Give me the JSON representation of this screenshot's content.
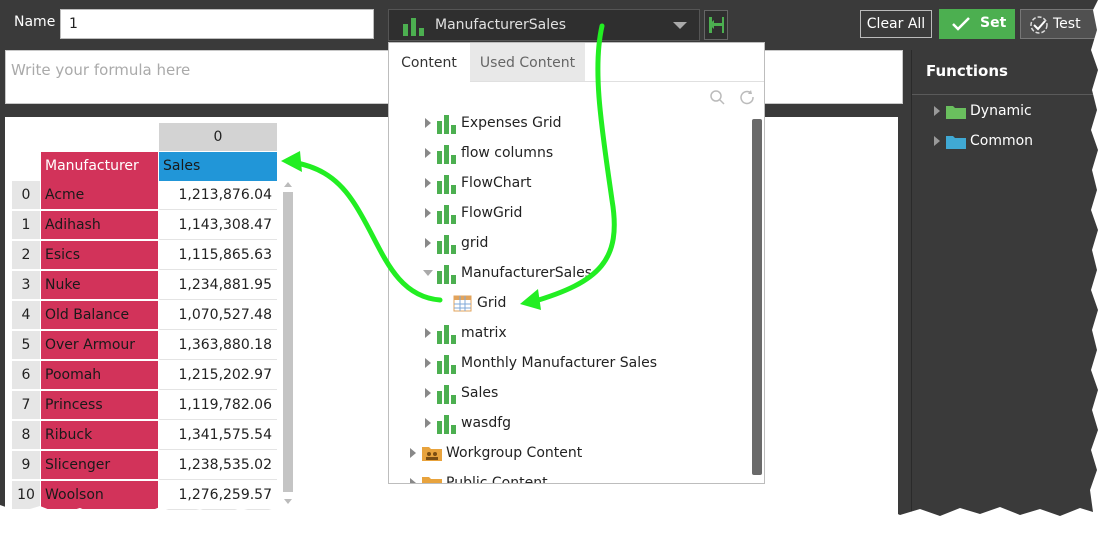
{
  "header": {
    "name_label": "Name",
    "name_value": "1",
    "source_select": "ManufacturerSales",
    "clear_label": "Clear All",
    "set_label": "Set",
    "test_label": "Test"
  },
  "formula": {
    "placeholder": "Write your formula here"
  },
  "functions": {
    "title": "Functions",
    "items": [
      {
        "label": "Dynamic",
        "color": "#6abf5e"
      },
      {
        "label": "Common",
        "color": "#40a9d4"
      }
    ]
  },
  "grid": {
    "column_index": "0",
    "headers": [
      "Manufacturer",
      "Sales"
    ],
    "rows": [
      {
        "idx": "0",
        "manufacturer": "Acme",
        "sales": "1,213,876.04"
      },
      {
        "idx": "1",
        "manufacturer": "Adihash",
        "sales": "1,143,308.47"
      },
      {
        "idx": "2",
        "manufacturer": "Esics",
        "sales": "1,115,865.63"
      },
      {
        "idx": "3",
        "manufacturer": "Nuke",
        "sales": "1,234,881.95"
      },
      {
        "idx": "4",
        "manufacturer": "Old Balance",
        "sales": "1,070,527.48"
      },
      {
        "idx": "5",
        "manufacturer": "Over Armour",
        "sales": "1,363,880.18"
      },
      {
        "idx": "6",
        "manufacturer": "Poomah",
        "sales": "1,215,202.97"
      },
      {
        "idx": "7",
        "manufacturer": "Princess",
        "sales": "1,119,782.06"
      },
      {
        "idx": "8",
        "manufacturer": "Ribuck",
        "sales": "1,341,575.54"
      },
      {
        "idx": "9",
        "manufacturer": "Slicenger",
        "sales": "1,238,535.02"
      },
      {
        "idx": "10",
        "manufacturer": "Woolson",
        "sales": "1,276,259.57"
      }
    ]
  },
  "dropdown": {
    "tabs": [
      "Content",
      "Used Content"
    ],
    "tree": [
      "Expenses Grid",
      "flow columns",
      "FlowChart",
      "FlowGrid",
      "grid",
      "ManufacturerSales",
      "Grid",
      "matrix",
      "Monthly Manufacturer Sales",
      "Sales",
      "wasdfg",
      "Workgroup Content",
      "Public Content"
    ]
  },
  "colors": {
    "accent_green": "#4caf50",
    "manufacturer_pink": "#d2335a",
    "sales_blue": "#2196d8",
    "arrow_green": "#22ee22"
  }
}
